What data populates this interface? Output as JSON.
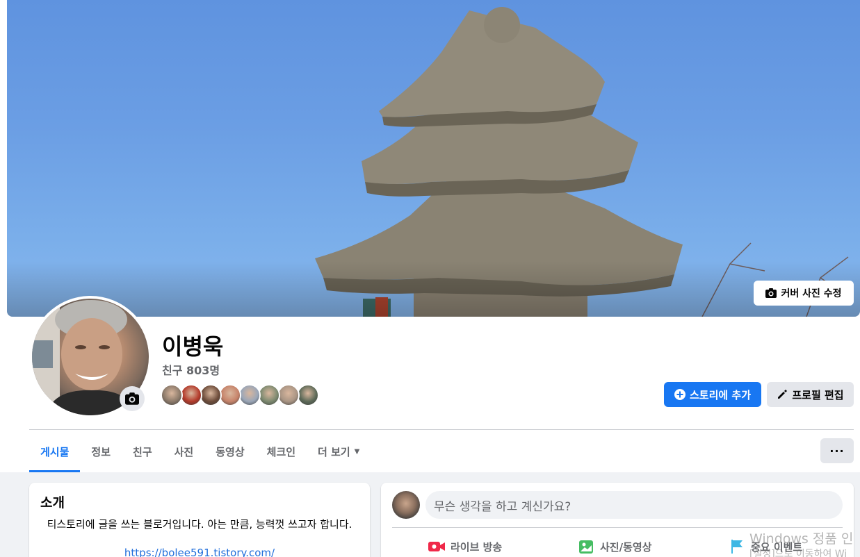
{
  "cover": {
    "edit_label": "커버 사진 수정"
  },
  "profile": {
    "name": "이병욱",
    "friend_count": "친구 803명",
    "friend_avatar_colors": [
      "#8c7a6a",
      "#b33a2a",
      "#6d4c3a",
      "#c6836a",
      "#9aa6b8",
      "#7d8a70",
      "#a99584",
      "#5d6a58"
    ]
  },
  "actions": {
    "add_story": "스토리에 추가",
    "edit_profile": "프로필 편집",
    "more": "···"
  },
  "tabs": [
    {
      "label": "게시물",
      "active": true
    },
    {
      "label": "정보"
    },
    {
      "label": "친구"
    },
    {
      "label": "사진"
    },
    {
      "label": "동영상"
    },
    {
      "label": "체크인"
    },
    {
      "label": "더 보기"
    }
  ],
  "intro": {
    "title": "소개",
    "bio": "티스토리에 글을 쓰는 블로거입니다. 아는 만큼, 능력껏 쓰고자 합니다.",
    "link": "https://bolee591.tistory.com/"
  },
  "composer": {
    "placeholder": "무슨 생각을 하고 계신가요?",
    "live": "라이브 방송",
    "photo": "사진/동영상",
    "event": "중요 이벤트"
  },
  "watermark": {
    "line1": "Windows 정품 인",
    "line2": "[설정]으로 이동하여 Wi"
  },
  "colors": {
    "accent": "#1877f2",
    "live_red": "#f02849",
    "photo_green": "#45bd62",
    "event_teal": "#3db7e4"
  }
}
